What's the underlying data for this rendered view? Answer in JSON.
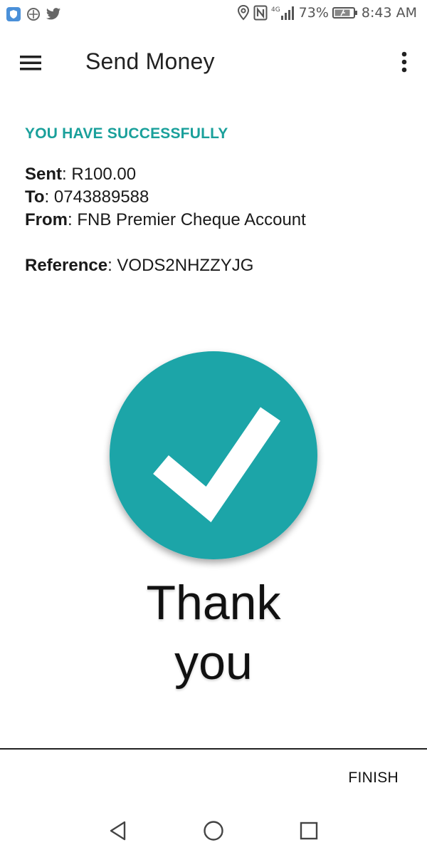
{
  "status_bar": {
    "left_icons": [
      "shield-app-icon",
      "sync-icon",
      "twitter-icon"
    ],
    "right_icons": [
      "location-icon",
      "nfc-icon",
      "signal-icon",
      "battery-icon"
    ],
    "network": "4G",
    "battery": "73%",
    "time": "8:43 AM"
  },
  "app_bar": {
    "title": "Send Money",
    "menu_icon": "hamburger-menu-icon",
    "overflow_icon": "more-vert-icon"
  },
  "result": {
    "heading": "YOU HAVE SUCCESSFULLY",
    "sent_label": "Sent",
    "sent_value": "R100.00",
    "to_label": "To",
    "to_value": "0743889588",
    "from_label": "From",
    "from_value": "FNB Premier Cheque Account",
    "reference_label": "Reference",
    "reference_value": "VODS2NHZZYJG"
  },
  "success_graphic": {
    "icon": "check-circle-icon",
    "line1": "Thank",
    "line2": "you"
  },
  "footer": {
    "finish_label": "FINISH"
  },
  "nav_bar": {
    "back_icon": "back-icon",
    "home_icon": "home-icon",
    "recents_icon": "recents-icon"
  },
  "colors": {
    "accent": "#1aa09b",
    "check_circle": "#1aa5a8"
  }
}
